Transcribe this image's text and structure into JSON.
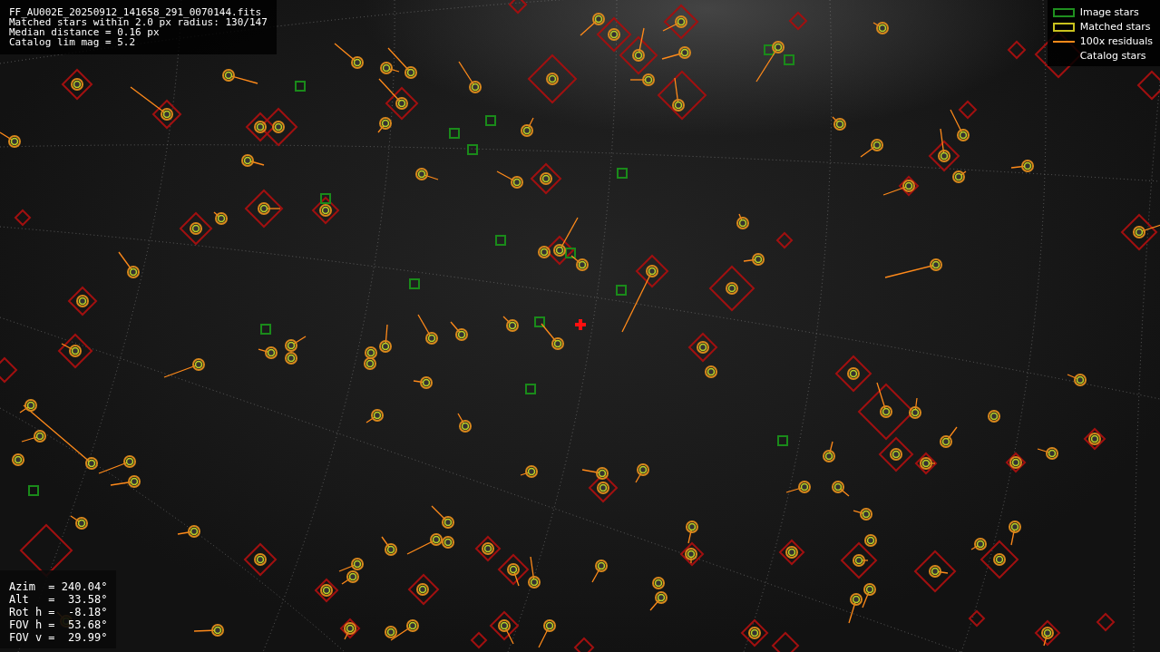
{
  "info_header": {
    "lines": [
      "FF_AU002E_20250912_141658_291_0070144.fits",
      "Matched stars within 2.0 px radius: 130/147",
      "Median distance = 0.16 px",
      "Catalog lim mag = 5.2"
    ]
  },
  "legend": {
    "items": [
      {
        "label": "Image stars",
        "kind": "box",
        "color": "#1f8f1f"
      },
      {
        "label": "Matched stars",
        "kind": "box",
        "color": "#c9c21e"
      },
      {
        "label": "100x residuals",
        "kind": "line",
        "color": "#ff8a1a"
      },
      {
        "label": "Catalog stars",
        "kind": "none"
      }
    ]
  },
  "pointing": {
    "lines": [
      "Azim  = 240.04°",
      "Alt   =  33.58°",
      "Rot h =  -8.18°",
      "FOV h =  53.68°",
      "FOV v =  29.99°"
    ]
  }
}
